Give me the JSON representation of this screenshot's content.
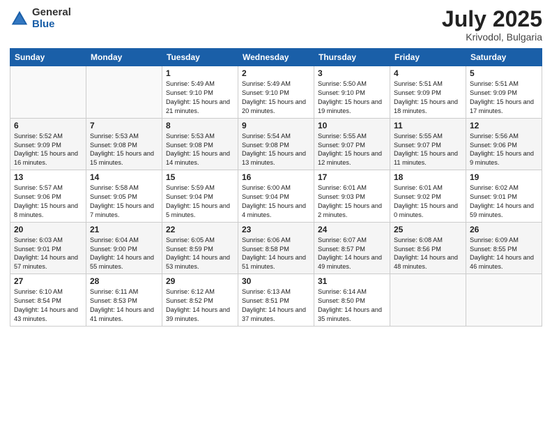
{
  "logo": {
    "general": "General",
    "blue": "Blue"
  },
  "title": "July 2025",
  "location": "Krivodol, Bulgaria",
  "weekdays": [
    "Sunday",
    "Monday",
    "Tuesday",
    "Wednesday",
    "Thursday",
    "Friday",
    "Saturday"
  ],
  "weeks": [
    [
      {
        "day": "",
        "info": ""
      },
      {
        "day": "",
        "info": ""
      },
      {
        "day": "1",
        "info": "Sunrise: 5:49 AM\nSunset: 9:10 PM\nDaylight: 15 hours and 21 minutes."
      },
      {
        "day": "2",
        "info": "Sunrise: 5:49 AM\nSunset: 9:10 PM\nDaylight: 15 hours and 20 minutes."
      },
      {
        "day": "3",
        "info": "Sunrise: 5:50 AM\nSunset: 9:10 PM\nDaylight: 15 hours and 19 minutes."
      },
      {
        "day": "4",
        "info": "Sunrise: 5:51 AM\nSunset: 9:09 PM\nDaylight: 15 hours and 18 minutes."
      },
      {
        "day": "5",
        "info": "Sunrise: 5:51 AM\nSunset: 9:09 PM\nDaylight: 15 hours and 17 minutes."
      }
    ],
    [
      {
        "day": "6",
        "info": "Sunrise: 5:52 AM\nSunset: 9:09 PM\nDaylight: 15 hours and 16 minutes."
      },
      {
        "day": "7",
        "info": "Sunrise: 5:53 AM\nSunset: 9:08 PM\nDaylight: 15 hours and 15 minutes."
      },
      {
        "day": "8",
        "info": "Sunrise: 5:53 AM\nSunset: 9:08 PM\nDaylight: 15 hours and 14 minutes."
      },
      {
        "day": "9",
        "info": "Sunrise: 5:54 AM\nSunset: 9:08 PM\nDaylight: 15 hours and 13 minutes."
      },
      {
        "day": "10",
        "info": "Sunrise: 5:55 AM\nSunset: 9:07 PM\nDaylight: 15 hours and 12 minutes."
      },
      {
        "day": "11",
        "info": "Sunrise: 5:55 AM\nSunset: 9:07 PM\nDaylight: 15 hours and 11 minutes."
      },
      {
        "day": "12",
        "info": "Sunrise: 5:56 AM\nSunset: 9:06 PM\nDaylight: 15 hours and 9 minutes."
      }
    ],
    [
      {
        "day": "13",
        "info": "Sunrise: 5:57 AM\nSunset: 9:06 PM\nDaylight: 15 hours and 8 minutes."
      },
      {
        "day": "14",
        "info": "Sunrise: 5:58 AM\nSunset: 9:05 PM\nDaylight: 15 hours and 7 minutes."
      },
      {
        "day": "15",
        "info": "Sunrise: 5:59 AM\nSunset: 9:04 PM\nDaylight: 15 hours and 5 minutes."
      },
      {
        "day": "16",
        "info": "Sunrise: 6:00 AM\nSunset: 9:04 PM\nDaylight: 15 hours and 4 minutes."
      },
      {
        "day": "17",
        "info": "Sunrise: 6:01 AM\nSunset: 9:03 PM\nDaylight: 15 hours and 2 minutes."
      },
      {
        "day": "18",
        "info": "Sunrise: 6:01 AM\nSunset: 9:02 PM\nDaylight: 15 hours and 0 minutes."
      },
      {
        "day": "19",
        "info": "Sunrise: 6:02 AM\nSunset: 9:01 PM\nDaylight: 14 hours and 59 minutes."
      }
    ],
    [
      {
        "day": "20",
        "info": "Sunrise: 6:03 AM\nSunset: 9:01 PM\nDaylight: 14 hours and 57 minutes."
      },
      {
        "day": "21",
        "info": "Sunrise: 6:04 AM\nSunset: 9:00 PM\nDaylight: 14 hours and 55 minutes."
      },
      {
        "day": "22",
        "info": "Sunrise: 6:05 AM\nSunset: 8:59 PM\nDaylight: 14 hours and 53 minutes."
      },
      {
        "day": "23",
        "info": "Sunrise: 6:06 AM\nSunset: 8:58 PM\nDaylight: 14 hours and 51 minutes."
      },
      {
        "day": "24",
        "info": "Sunrise: 6:07 AM\nSunset: 8:57 PM\nDaylight: 14 hours and 49 minutes."
      },
      {
        "day": "25",
        "info": "Sunrise: 6:08 AM\nSunset: 8:56 PM\nDaylight: 14 hours and 48 minutes."
      },
      {
        "day": "26",
        "info": "Sunrise: 6:09 AM\nSunset: 8:55 PM\nDaylight: 14 hours and 46 minutes."
      }
    ],
    [
      {
        "day": "27",
        "info": "Sunrise: 6:10 AM\nSunset: 8:54 PM\nDaylight: 14 hours and 43 minutes."
      },
      {
        "day": "28",
        "info": "Sunrise: 6:11 AM\nSunset: 8:53 PM\nDaylight: 14 hours and 41 minutes."
      },
      {
        "day": "29",
        "info": "Sunrise: 6:12 AM\nSunset: 8:52 PM\nDaylight: 14 hours and 39 minutes."
      },
      {
        "day": "30",
        "info": "Sunrise: 6:13 AM\nSunset: 8:51 PM\nDaylight: 14 hours and 37 minutes."
      },
      {
        "day": "31",
        "info": "Sunrise: 6:14 AM\nSunset: 8:50 PM\nDaylight: 14 hours and 35 minutes."
      },
      {
        "day": "",
        "info": ""
      },
      {
        "day": "",
        "info": ""
      }
    ]
  ]
}
